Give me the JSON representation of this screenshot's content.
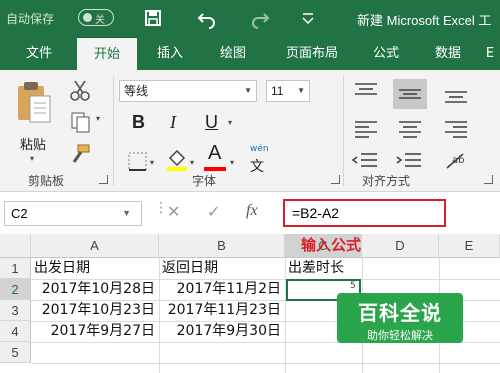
{
  "titlebar": {
    "autosave_label": "自动保存",
    "autosave_state": "关",
    "doc_title": "新建 Microsoft Excel 工"
  },
  "tabs": [
    {
      "label": "文件",
      "active": false
    },
    {
      "label": "开始",
      "active": true
    },
    {
      "label": "插入",
      "active": false
    },
    {
      "label": "绘图",
      "active": false
    },
    {
      "label": "页面布局",
      "active": false
    },
    {
      "label": "公式",
      "active": false
    },
    {
      "label": "数据",
      "active": false
    },
    {
      "label": "E",
      "active": false
    }
  ],
  "ribbon": {
    "paste_label": "粘贴",
    "clipboard_group": "剪贴板",
    "font_group": "字体",
    "alignment_group": "对齐方式",
    "font_name": "等线",
    "font_size": "11",
    "bold": "B",
    "italic": "I",
    "underline": "U",
    "font_color_glyph": "A",
    "phonetic_top": "wén",
    "phonetic_bottom": "文"
  },
  "formula_bar": {
    "name_box": "C2",
    "fx": "fx",
    "formula": "=B2-A2"
  },
  "annotation": "输入公式",
  "columns": [
    "A",
    "B",
    "C",
    "D",
    "E"
  ],
  "rows": [
    "1",
    "2",
    "3",
    "4",
    "5"
  ],
  "cells": {
    "A1": "出发日期",
    "B1": "返回日期",
    "C1": "出差时长",
    "A2": "2017年10月28日",
    "B2": "2017年11月2日",
    "C2": "5",
    "A3": "2017年10月23日",
    "B3": "2017年11月23日",
    "A4": "2017年9月27日",
    "B4": "2017年9月30日"
  },
  "watermark": {
    "title": "百科全说",
    "subtitle": "助你轻松解决"
  },
  "colors": {
    "excel_green": "#217346",
    "highlight_red": "#d8202a",
    "fill_yellow": "#ffff00",
    "font_red": "#ff0000"
  }
}
